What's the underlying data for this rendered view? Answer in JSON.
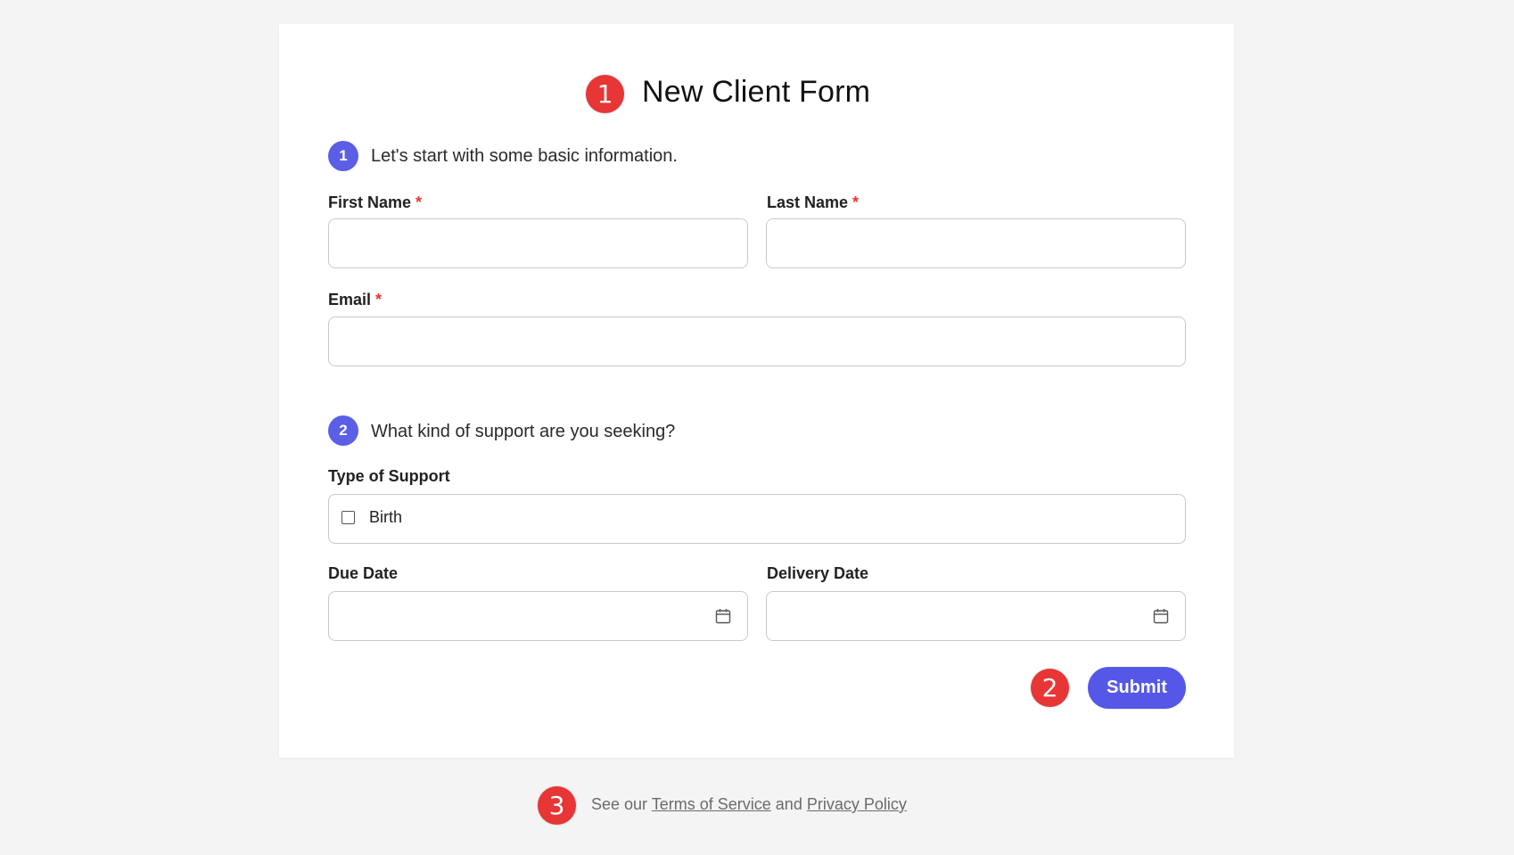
{
  "form": {
    "title": "New Client Form",
    "submit_label": "Submit"
  },
  "annotations": {
    "marker_1": "1",
    "marker_2": "2",
    "marker_3": "3"
  },
  "sections": [
    {
      "number": "1",
      "heading": "Let's start with some basic information."
    },
    {
      "number": "2",
      "heading": "What kind of support are you seeking?"
    }
  ],
  "fields": {
    "first_name": {
      "label": "First Name",
      "required_mark": "*",
      "value": ""
    },
    "last_name": {
      "label": "Last Name",
      "required_mark": "*",
      "value": ""
    },
    "email": {
      "label": "Email",
      "required_mark": "*",
      "value": ""
    },
    "type_of_support": {
      "label": "Type of Support",
      "options": [
        {
          "label": "Birth",
          "checked": false
        }
      ]
    },
    "due_date": {
      "label": "Due Date",
      "value": "",
      "icon": "calendar-icon"
    },
    "delivery_date": {
      "label": "Delivery Date",
      "value": "",
      "icon": "calendar-icon"
    }
  },
  "footer": {
    "prefix": "See our",
    "terms_link": "Terms of Service",
    "conjunction": "and",
    "privacy_link": "Privacy Policy"
  },
  "colors": {
    "accent": "#5558e6",
    "marker": "#e83535",
    "required": "#e53935",
    "background": "#f4f4f4",
    "card": "#ffffff"
  }
}
